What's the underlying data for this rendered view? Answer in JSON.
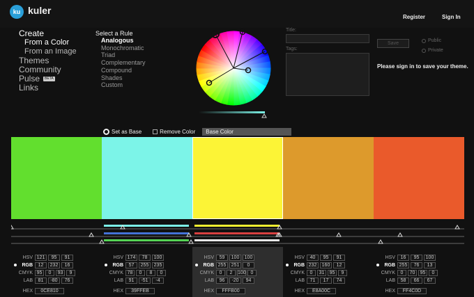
{
  "header": {
    "app_name": "kuler",
    "logo_text": "ku",
    "register": "Register",
    "signin": "Sign In"
  },
  "nav": {
    "create": "Create",
    "from_color": "From a Color",
    "from_image": "From an Image",
    "themes": "Themes",
    "community": "Community",
    "pulse": "Pulse",
    "beta": "BETA",
    "links": "Links"
  },
  "rules": {
    "title": "Select a Rule",
    "items": [
      "Analogous",
      "Monochromatic",
      "Triad",
      "Complementary",
      "Compound",
      "Shades",
      "Custom"
    ],
    "selected": 0
  },
  "form": {
    "title_label": "Title:",
    "tags_label": "Tags:",
    "save": "Save",
    "public": "Public",
    "private": "Private",
    "signin_msg": "Please sign in to save your theme."
  },
  "toolbar": {
    "set_base": "Set as Base",
    "remove": "Remove Color",
    "base_color": "Base Color"
  },
  "labels": {
    "hsv": "HSV",
    "rgb": "RGB",
    "cmyk": "CMYK",
    "lab": "LAB",
    "hex": "HEX"
  },
  "swatches": [
    {
      "color": "#0CE810",
      "hsv": [
        "121",
        "95",
        "91"
      ],
      "rgb": [
        "12",
        "232",
        "16"
      ],
      "cmyk": [
        "95",
        "0",
        "93",
        "9"
      ],
      "lab": [
        "81",
        "-80",
        "76"
      ],
      "hex": "0CE810"
    },
    {
      "color": "#39FFEB",
      "hsv": [
        "174",
        "78",
        "100"
      ],
      "rgb": [
        "57",
        "255",
        "235"
      ],
      "cmyk": [
        "78",
        "0",
        "8",
        "0"
      ],
      "lab": [
        "91",
        "-51",
        "-4"
      ],
      "hex": "39FFEB"
    },
    {
      "color": "#FFFB00",
      "hsv": [
        "59",
        "100",
        "100"
      ],
      "rgb": [
        "255",
        "251",
        "0"
      ],
      "cmyk": [
        "0",
        "2",
        "100",
        "0"
      ],
      "lab": [
        "96",
        "-20",
        "94"
      ],
      "hex": "FFFB00"
    },
    {
      "color": "#E8A00C",
      "hsv": [
        "40",
        "95",
        "91"
      ],
      "rgb": [
        "232",
        "160",
        "12"
      ],
      "cmyk": [
        "0",
        "31",
        "95",
        "9"
      ],
      "lab": [
        "71",
        "17",
        "74"
      ],
      "hex": "E8A00C"
    },
    {
      "color": "#FF4C0D",
      "hsv": [
        "16",
        "95",
        "100"
      ],
      "rgb": [
        "255",
        "76",
        "13"
      ],
      "cmyk": [
        "0",
        "70",
        "95",
        "0"
      ],
      "lab": [
        "58",
        "66",
        "67"
      ],
      "hex": "FF4C0D"
    }
  ],
  "display_colors": [
    "#62df2e",
    "#7cf4e8",
    "#fcf436",
    "#dd9a2c",
    "#ea5a2b"
  ],
  "selected_index": 2
}
